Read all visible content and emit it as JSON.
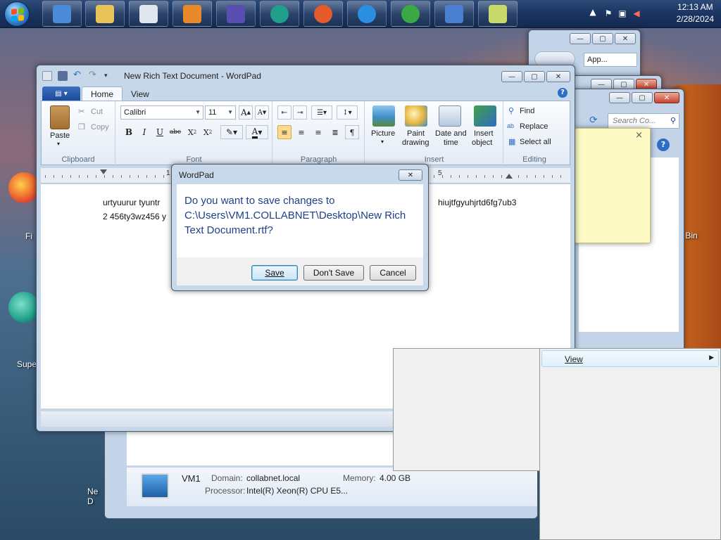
{
  "taskbar": {
    "clock_time": "12:13 AM",
    "clock_date": "2/28/2024",
    "pinned": [
      {
        "name": "control-panel-icon",
        "color": "#4a8ad6"
      },
      {
        "name": "explorer-icon",
        "color": "#e8c35a"
      },
      {
        "name": "calculator-icon",
        "color": "#dfe6ee"
      },
      {
        "name": "media-player-icon",
        "color": "#e98a2a"
      },
      {
        "name": "visual-studio-icon",
        "color": "#5a4fb0"
      },
      {
        "name": "teams-icon",
        "color": "#1f9f8a"
      },
      {
        "name": "firefox-icon",
        "color": "#e55b2b"
      },
      {
        "name": "internet-explorer-icon",
        "color": "#2a8fe0"
      },
      {
        "name": "windows-media-center-icon",
        "color": "#3ca844"
      },
      {
        "name": "wordpad-icon",
        "color": "#4a7fd0"
      },
      {
        "name": "sticky-notes-icon",
        "color": "#c9d96a"
      }
    ]
  },
  "wordpad": {
    "title": "New Rich Text Document - WordPad",
    "tabs": [
      "Home",
      "View"
    ],
    "clipboard": {
      "paste": "Paste",
      "cut": "Cut",
      "copy": "Copy",
      "group": "Clipboard"
    },
    "font": {
      "family": "Calibri",
      "size": "11",
      "group": "Font"
    },
    "paragraph": {
      "group": "Paragraph"
    },
    "insert": {
      "picture": "Picture",
      "paint1": "Paint",
      "paint2": "drawing",
      "date1": "Date and",
      "date2": "time",
      "obj1": "Insert",
      "obj2": "object",
      "group": "Insert"
    },
    "editing": {
      "find": "Find",
      "replace": "Replace",
      "select_all": "Select all",
      "group": "Editing"
    },
    "ruler": {
      "one": "1",
      "five": "5"
    },
    "document": {
      "line1_left": "urtyuurur tyuntr",
      "line1_right": "hiujtfgyuhjrtd6fg7ub3",
      "line2_left": "2 456ty3wz456 y"
    }
  },
  "dialog": {
    "title": "WordPad",
    "message": "Do you want to save changes to C:\\Users\\VM1.COLLABNET\\Desktop\\New Rich Text Document.rtf?",
    "save": "Save",
    "dont_save": "Don't Save",
    "cancel": "Cancel"
  },
  "explorer_back": {
    "breadcrumb": "App..."
  },
  "explorer_front": {
    "search_placeholder": "Search Co..."
  },
  "desktop_icons": {
    "bin": "Bin",
    "fi": "Fi",
    "supe": "Supe",
    "ne": "Ne",
    "d": "D"
  },
  "sysinfo": {
    "name": "VM1",
    "domain_label": "Domain:",
    "domain": "collabnet.local",
    "memory_label": "Memory:",
    "memory": "4.00 GB",
    "processor_label": "Processor:",
    "processor": "Intel(R) Xeon(R) CPU E5..."
  },
  "context_menu": {
    "view": "View"
  }
}
